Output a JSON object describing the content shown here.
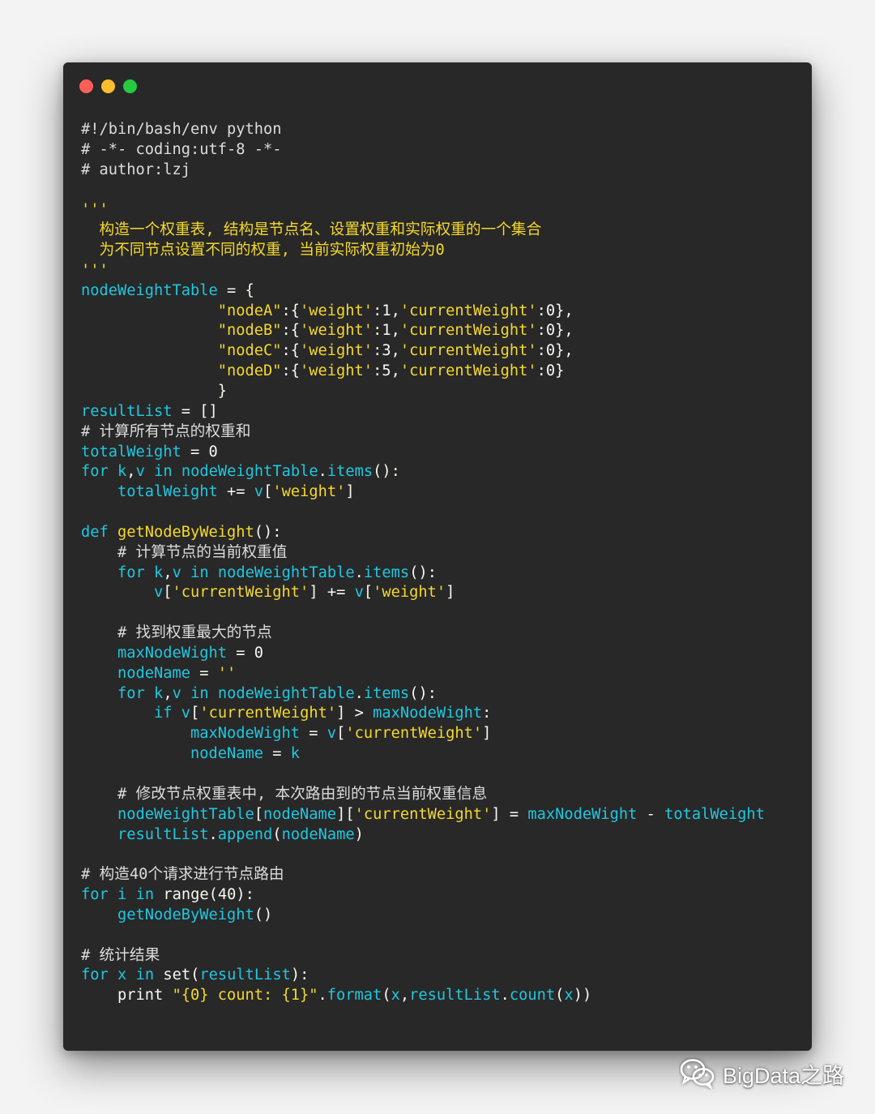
{
  "window": {
    "controls": [
      {
        "name": "close",
        "color": "#ff5f56"
      },
      {
        "name": "minimize",
        "color": "#ffbd2e"
      },
      {
        "name": "maximize",
        "color": "#27c93f"
      }
    ]
  },
  "theme": {
    "background": "#282828",
    "keyword_color": "#1fc7e0",
    "string_color": "#f5d82c",
    "text_color": "#f8f8f2"
  },
  "code": {
    "lines": [
      [
        [
          "cm",
          "#!/bin/bash/env python"
        ]
      ],
      [
        [
          "cm",
          "# -*- coding:utf-8 -*-"
        ]
      ],
      [
        [
          "cm",
          "# author:lzj"
        ]
      ],
      [],
      [
        [
          "st",
          "'''"
        ]
      ],
      [
        [
          "st",
          "  构造一个权重表, 结构是节点名、设置权重和实际权重的一个集合"
        ]
      ],
      [
        [
          "st",
          "  为不同节点设置不同的权重, 当前实际权重初始为0"
        ]
      ],
      [
        [
          "st",
          "'''"
        ]
      ],
      [
        [
          "id",
          "nodeWeightTable"
        ],
        [
          "op",
          " = {"
        ]
      ],
      [
        [
          "pl",
          "               "
        ],
        [
          "st",
          "\"nodeA\""
        ],
        [
          "op",
          ":{"
        ],
        [
          "st",
          "'weight'"
        ],
        [
          "op",
          ":1,"
        ],
        [
          "st",
          "'currentWeight'"
        ],
        [
          "op",
          ":0},"
        ]
      ],
      [
        [
          "pl",
          "               "
        ],
        [
          "st",
          "\"nodeB\""
        ],
        [
          "op",
          ":{"
        ],
        [
          "st",
          "'weight'"
        ],
        [
          "op",
          ":1,"
        ],
        [
          "st",
          "'currentWeight'"
        ],
        [
          "op",
          ":0},"
        ]
      ],
      [
        [
          "pl",
          "               "
        ],
        [
          "st",
          "\"nodeC\""
        ],
        [
          "op",
          ":{"
        ],
        [
          "st",
          "'weight'"
        ],
        [
          "op",
          ":3,"
        ],
        [
          "st",
          "'currentWeight'"
        ],
        [
          "op",
          ":0},"
        ]
      ],
      [
        [
          "pl",
          "               "
        ],
        [
          "st",
          "\"nodeD\""
        ],
        [
          "op",
          ":{"
        ],
        [
          "st",
          "'weight'"
        ],
        [
          "op",
          ":5,"
        ],
        [
          "st",
          "'currentWeight'"
        ],
        [
          "op",
          ":0}"
        ]
      ],
      [
        [
          "op",
          "               }"
        ]
      ],
      [
        [
          "id",
          "resultList"
        ],
        [
          "op",
          " = []"
        ]
      ],
      [
        [
          "cm",
          "# 计算所有节点的权重和"
        ]
      ],
      [
        [
          "id",
          "totalWeight"
        ],
        [
          "op",
          " = "
        ],
        [
          "nm",
          "0"
        ]
      ],
      [
        [
          "kw",
          "for"
        ],
        [
          "pl",
          " "
        ],
        [
          "id",
          "k"
        ],
        [
          "op",
          ","
        ],
        [
          "id",
          "v"
        ],
        [
          "pl",
          " "
        ],
        [
          "kw",
          "in"
        ],
        [
          "pl",
          " "
        ],
        [
          "id",
          "nodeWeightTable"
        ],
        [
          "op",
          "."
        ],
        [
          "id",
          "items"
        ],
        [
          "op",
          "():"
        ]
      ],
      [
        [
          "pl",
          "    "
        ],
        [
          "id",
          "totalWeight"
        ],
        [
          "op",
          " += "
        ],
        [
          "id",
          "v"
        ],
        [
          "op",
          "["
        ],
        [
          "st",
          "'weight'"
        ],
        [
          "op",
          "]"
        ]
      ],
      [],
      [
        [
          "kw",
          "def"
        ],
        [
          "pl",
          " "
        ],
        [
          "fn",
          "getNodeByWeight"
        ],
        [
          "op",
          "():"
        ]
      ],
      [
        [
          "pl",
          "    "
        ],
        [
          "cm",
          "# 计算节点的当前权重值"
        ]
      ],
      [
        [
          "pl",
          "    "
        ],
        [
          "kw",
          "for"
        ],
        [
          "pl",
          " "
        ],
        [
          "id",
          "k"
        ],
        [
          "op",
          ","
        ],
        [
          "id",
          "v"
        ],
        [
          "pl",
          " "
        ],
        [
          "kw",
          "in"
        ],
        [
          "pl",
          " "
        ],
        [
          "id",
          "nodeWeightTable"
        ],
        [
          "op",
          "."
        ],
        [
          "id",
          "items"
        ],
        [
          "op",
          "():"
        ]
      ],
      [
        [
          "pl",
          "        "
        ],
        [
          "id",
          "v"
        ],
        [
          "op",
          "["
        ],
        [
          "st",
          "'currentWeight'"
        ],
        [
          "op",
          "] += "
        ],
        [
          "id",
          "v"
        ],
        [
          "op",
          "["
        ],
        [
          "st",
          "'weight'"
        ],
        [
          "op",
          "]"
        ]
      ],
      [],
      [
        [
          "pl",
          "    "
        ],
        [
          "cm",
          "# 找到权重最大的节点"
        ]
      ],
      [
        [
          "pl",
          "    "
        ],
        [
          "id",
          "maxNodeWight"
        ],
        [
          "op",
          " = "
        ],
        [
          "nm",
          "0"
        ]
      ],
      [
        [
          "pl",
          "    "
        ],
        [
          "id",
          "nodeName"
        ],
        [
          "op",
          " = "
        ],
        [
          "st",
          "''"
        ]
      ],
      [
        [
          "pl",
          "    "
        ],
        [
          "kw",
          "for"
        ],
        [
          "pl",
          " "
        ],
        [
          "id",
          "k"
        ],
        [
          "op",
          ","
        ],
        [
          "id",
          "v"
        ],
        [
          "pl",
          " "
        ],
        [
          "kw",
          "in"
        ],
        [
          "pl",
          " "
        ],
        [
          "id",
          "nodeWeightTable"
        ],
        [
          "op",
          "."
        ],
        [
          "id",
          "items"
        ],
        [
          "op",
          "():"
        ]
      ],
      [
        [
          "pl",
          "        "
        ],
        [
          "kw",
          "if"
        ],
        [
          "pl",
          " "
        ],
        [
          "id",
          "v"
        ],
        [
          "op",
          "["
        ],
        [
          "st",
          "'currentWeight'"
        ],
        [
          "op",
          "] > "
        ],
        [
          "id",
          "maxNodeWight"
        ],
        [
          "op",
          ":"
        ]
      ],
      [
        [
          "pl",
          "            "
        ],
        [
          "id",
          "maxNodeWight"
        ],
        [
          "op",
          " = "
        ],
        [
          "id",
          "v"
        ],
        [
          "op",
          "["
        ],
        [
          "st",
          "'currentWeight'"
        ],
        [
          "op",
          "]"
        ]
      ],
      [
        [
          "pl",
          "            "
        ],
        [
          "id",
          "nodeName"
        ],
        [
          "op",
          " = "
        ],
        [
          "id",
          "k"
        ]
      ],
      [],
      [
        [
          "pl",
          "    "
        ],
        [
          "cm",
          "# 修改节点权重表中, 本次路由到的节点当前权重信息"
        ]
      ],
      [
        [
          "pl",
          "    "
        ],
        [
          "id",
          "nodeWeightTable"
        ],
        [
          "op",
          "["
        ],
        [
          "id",
          "nodeName"
        ],
        [
          "op",
          "]["
        ],
        [
          "st",
          "'currentWeight'"
        ],
        [
          "op",
          "] = "
        ],
        [
          "id",
          "maxNodeWight"
        ],
        [
          "op",
          " - "
        ],
        [
          "id",
          "totalWeight"
        ]
      ],
      [
        [
          "pl",
          "    "
        ],
        [
          "id",
          "resultList"
        ],
        [
          "op",
          "."
        ],
        [
          "id",
          "append"
        ],
        [
          "op",
          "("
        ],
        [
          "id",
          "nodeName"
        ],
        [
          "op",
          ")"
        ]
      ],
      [],
      [
        [
          "cm",
          "# 构造40个请求进行节点路由"
        ]
      ],
      [
        [
          "kw",
          "for"
        ],
        [
          "pl",
          " "
        ],
        [
          "id",
          "i"
        ],
        [
          "pl",
          " "
        ],
        [
          "kw",
          "in"
        ],
        [
          "pl",
          " "
        ],
        [
          "pl",
          "range"
        ],
        [
          "op",
          "("
        ],
        [
          "nm",
          "40"
        ],
        [
          "op",
          "):"
        ]
      ],
      [
        [
          "pl",
          "    "
        ],
        [
          "id",
          "getNodeByWeight"
        ],
        [
          "op",
          "()"
        ]
      ],
      [],
      [
        [
          "cm",
          "# 统计结果"
        ]
      ],
      [
        [
          "kw",
          "for"
        ],
        [
          "pl",
          " "
        ],
        [
          "id",
          "x"
        ],
        [
          "pl",
          " "
        ],
        [
          "kw",
          "in"
        ],
        [
          "pl",
          " "
        ],
        [
          "pl",
          "set"
        ],
        [
          "op",
          "("
        ],
        [
          "id",
          "resultList"
        ],
        [
          "op",
          "):"
        ]
      ],
      [
        [
          "pl",
          "    print "
        ],
        [
          "st",
          "\"{0} count: {1}\""
        ],
        [
          "op",
          "."
        ],
        [
          "id",
          "format"
        ],
        [
          "op",
          "("
        ],
        [
          "id",
          "x"
        ],
        [
          "op",
          ","
        ],
        [
          "id",
          "resultList"
        ],
        [
          "op",
          "."
        ],
        [
          "id",
          "count"
        ],
        [
          "op",
          "("
        ],
        [
          "id",
          "x"
        ],
        [
          "op",
          "))"
        ]
      ]
    ]
  },
  "watermark": {
    "icon": "wechat-icon",
    "text": "BigData之路"
  }
}
